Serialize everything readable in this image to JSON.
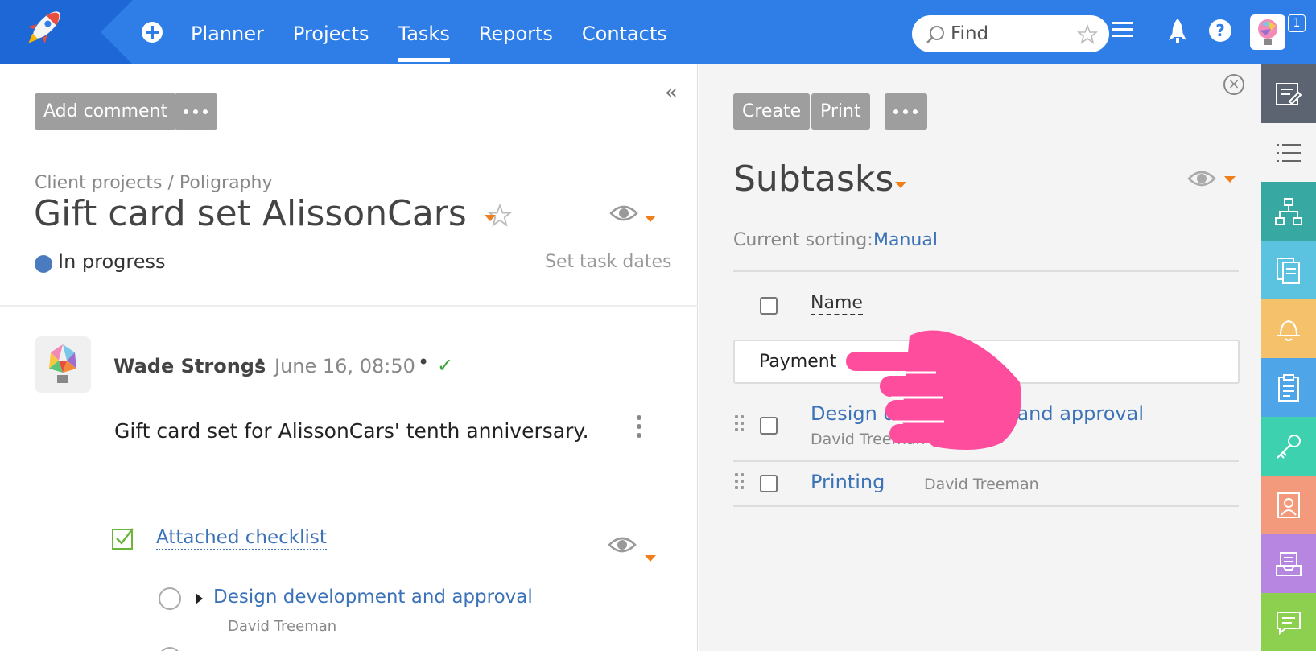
{
  "topbar": {
    "nav": [
      {
        "label": "Planner"
      },
      {
        "label": "Projects"
      },
      {
        "label": "Tasks",
        "active": true
      },
      {
        "label": "Reports"
      },
      {
        "label": "Contacts"
      }
    ],
    "search_placeholder": "Find",
    "notification_count": "1"
  },
  "left": {
    "add_comment_label": "Add comment",
    "breadcrumb": "Client projects / Poligraphy",
    "title": "Gift card set AlissonCars",
    "status": "In progress",
    "set_dates_label": "Set task dates",
    "comment": {
      "author": "Wade Strongs",
      "date": "June 16, 08:50",
      "text": "Gift card set for AlissonCars' tenth anniversary."
    },
    "checklist": {
      "link": "Attached checklist",
      "item": "Design development and approval",
      "assignee": "David Treeman"
    }
  },
  "right": {
    "create_label": "Create",
    "print_label": "Print",
    "title": "Subtasks",
    "sorting_label": "Current sorting:",
    "sorting_value": "Manual",
    "column_name": "Name",
    "input_value": "Payment",
    "subtasks": [
      {
        "name": "Design development and approval",
        "assignee": "David Treeman"
      },
      {
        "name": "Printing",
        "assignee": "David Treeman"
      }
    ]
  },
  "colors": {
    "topbar": "#2f7ee8",
    "accent_orange": "#f07e1a",
    "link_blue": "#3c73b8",
    "button_gray": "#9e9e9e",
    "hand_pink": "#ff4d9d"
  },
  "rail_icons": [
    "edit-icon",
    "list-icon",
    "hierarchy-icon",
    "documents-icon",
    "bell-icon",
    "clipboard-icon",
    "key-icon",
    "contact-card-icon",
    "inbox-icon",
    "chat-icon"
  ]
}
